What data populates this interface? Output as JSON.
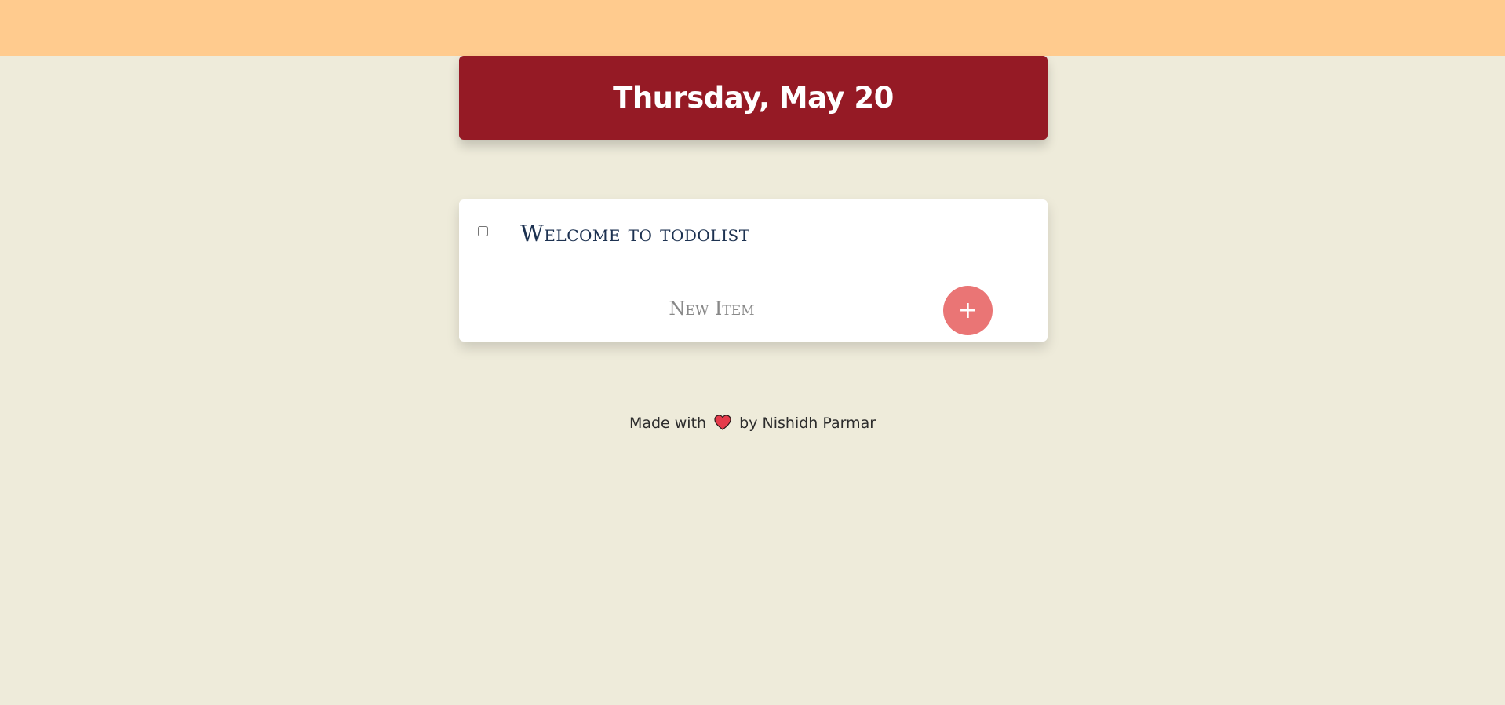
{
  "header": {
    "title": "Thursday, May 20"
  },
  "list": {
    "items": [
      {
        "text": "Welcome to todolist",
        "checked": false
      }
    ],
    "new_item": {
      "placeholder": "New Item",
      "value": ""
    },
    "add_button_label": "+"
  },
  "footer": {
    "prefix": "Made with",
    "heart_icon": "heart-icon",
    "suffix": "by Nishidh Parmar"
  },
  "colors": {
    "top_band": "#ffcb8e",
    "background": "#eeebda",
    "header_bg": "#951a25",
    "add_button": "#ea7575",
    "heart": "#e53b4b"
  }
}
